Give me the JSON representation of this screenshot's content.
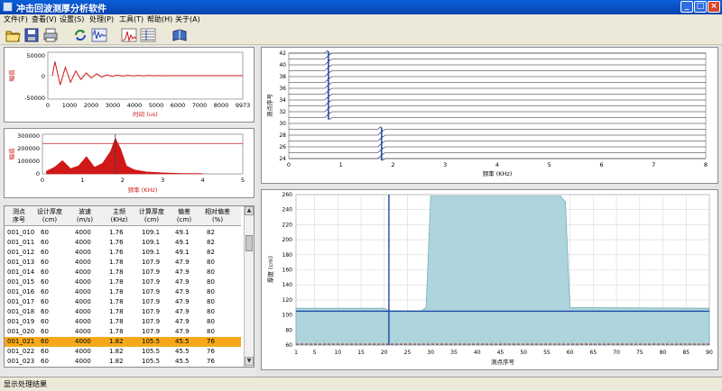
{
  "window": {
    "title": "冲击回波测厚分析软件",
    "minimize": "_",
    "maximize": "□",
    "close": "×"
  },
  "menu": [
    "文件(F)",
    "查看(V)",
    "设置(S)",
    "处理(P)",
    "工具(T)",
    "帮助(H)",
    "关于(A)"
  ],
  "toolbar": {
    "icons": [
      "open-folder-icon",
      "save-icon",
      "print-icon",
      "refresh-icon",
      "waveform-icon",
      "spectrum-icon",
      "waterfall-icon",
      "book-icon"
    ]
  },
  "colors": {
    "accent": "#0a5fd8",
    "signal": "#d01818",
    "area_fill": "#aed4dc",
    "thickness_line": "#1a4aa8",
    "selection": "#f5a91a"
  },
  "time_chart": {
    "chart_data": {
      "type": "line",
      "xlabel": "时间 (us)",
      "ylabel": "幅值",
      "xticks": [
        "0",
        "1000",
        "2000",
        "3000",
        "4000",
        "5000",
        "6000",
        "7000",
        "8000",
        "9973"
      ],
      "yticks": [
        "50000",
        "0",
        "-50000"
      ],
      "xlim": [
        0,
        9973
      ],
      "ylim": [
        -50000,
        50000
      ],
      "series": [
        {
          "values": [
            30000,
            -20000,
            18000,
            -14000,
            10000,
            -8000,
            6000,
            -5000,
            4000,
            -3000,
            2000,
            -1500,
            1200,
            -1000,
            800,
            -600,
            500,
            -400,
            300,
            -200,
            150,
            -100,
            80,
            -50,
            30,
            0
          ]
        }
      ]
    }
  },
  "spectrum_chart": {
    "chart_data": {
      "type": "area",
      "xlabel": "频率 (KHz)",
      "ylabel": "幅值",
      "xticks": [
        "0",
        "1",
        "2",
        "3",
        "4",
        "5"
      ],
      "yticks": [
        "300000",
        "200000",
        "100000",
        "0"
      ],
      "xlim": [
        0,
        5
      ],
      "ylim": [
        0,
        300000
      ],
      "x": [
        0.1,
        0.3,
        0.5,
        0.7,
        0.9,
        1.1,
        1.3,
        1.5,
        1.7,
        1.82,
        1.95,
        2.1,
        2.3,
        2.6,
        3.0,
        3.4,
        4.0
      ],
      "values": [
        20000,
        50000,
        100000,
        40000,
        60000,
        130000,
        50000,
        80000,
        170000,
        270000,
        190000,
        60000,
        30000,
        15000,
        8000,
        4000,
        2000
      ],
      "reference_line": 230000,
      "peak_marker": 1.82
    }
  },
  "waterfall_chart": {
    "chart_data": {
      "type": "line",
      "xlabel": "频率 (KHz)",
      "ylabel": "测点序号",
      "xticks": [
        "0",
        "1",
        "2",
        "3",
        "4",
        "5",
        "6",
        "7",
        "8"
      ],
      "yticks": [
        "24",
        "26",
        "28",
        "30",
        "32",
        "34",
        "36",
        "38",
        "40",
        "42"
      ],
      "xlim": [
        0,
        8
      ],
      "ylim": [
        24,
        42
      ],
      "peak_markers": [
        {
          "rows": "31-42",
          "freq": 0.76
        },
        {
          "rows": "24-29",
          "freq": 1.78
        }
      ]
    }
  },
  "thickness_chart": {
    "chart_data": {
      "type": "area",
      "xlabel": "测点序号",
      "ylabel": "厚度 (cm)",
      "xticks": [
        "1",
        "5",
        "10",
        "15",
        "20",
        "25",
        "30",
        "35",
        "40",
        "45",
        "50",
        "55",
        "60",
        "65",
        "70",
        "75",
        "80",
        "85",
        "90"
      ],
      "yticks": [
        "60",
        "80",
        "100",
        "120",
        "140",
        "160",
        "180",
        "200",
        "220",
        "240",
        "260"
      ],
      "xlim": [
        1,
        90
      ],
      "ylim": [
        60,
        260
      ],
      "x": [
        1,
        20,
        21,
        28,
        29,
        30,
        58,
        59,
        60,
        90
      ],
      "values": [
        109,
        109,
        105.5,
        105.5,
        110,
        258,
        258,
        250,
        110,
        109
      ],
      "design_thickness": 105,
      "lower_limit": 60,
      "cursor_point": 21
    }
  },
  "table": {
    "headers": [
      "测点\n序号",
      "设计厚度\n(cm)",
      "波速\n(m/s)",
      "主频\n(KHz)",
      "计算厚度\n(cm)",
      "偏差\n(cm)",
      "相对偏差\n(%)"
    ],
    "rows": [
      [
        "001_010",
        "60",
        "4000",
        "1.76",
        "109.1",
        "49.1",
        "82"
      ],
      [
        "001_011",
        "60",
        "4000",
        "1.76",
        "109.1",
        "49.1",
        "82"
      ],
      [
        "001_012",
        "60",
        "4000",
        "1.76",
        "109.1",
        "49.1",
        "82"
      ],
      [
        "001_013",
        "60",
        "4000",
        "1.78",
        "107.9",
        "47.9",
        "80"
      ],
      [
        "001_014",
        "60",
        "4000",
        "1.78",
        "107.9",
        "47.9",
        "80"
      ],
      [
        "001_015",
        "60",
        "4000",
        "1.78",
        "107.9",
        "47.9",
        "80"
      ],
      [
        "001_016",
        "60",
        "4000",
        "1.78",
        "107.9",
        "47.9",
        "80"
      ],
      [
        "001_017",
        "60",
        "4000",
        "1.78",
        "107.9",
        "47.9",
        "80"
      ],
      [
        "001_018",
        "60",
        "4000",
        "1.78",
        "107.9",
        "47.9",
        "80"
      ],
      [
        "001_019",
        "60",
        "4000",
        "1.78",
        "107.9",
        "47.9",
        "80"
      ],
      [
        "001_020",
        "60",
        "4000",
        "1.78",
        "107.9",
        "47.9",
        "80"
      ],
      [
        "001_021",
        "60",
        "4000",
        "1.82",
        "105.5",
        "45.5",
        "76"
      ],
      [
        "001_022",
        "60",
        "4000",
        "1.82",
        "105.5",
        "45.5",
        "76"
      ],
      [
        "001_023",
        "60",
        "4000",
        "1.82",
        "105.5",
        "45.5",
        "76"
      ]
    ],
    "selected_index": 11
  },
  "status": {
    "text": "显示处理结果"
  }
}
